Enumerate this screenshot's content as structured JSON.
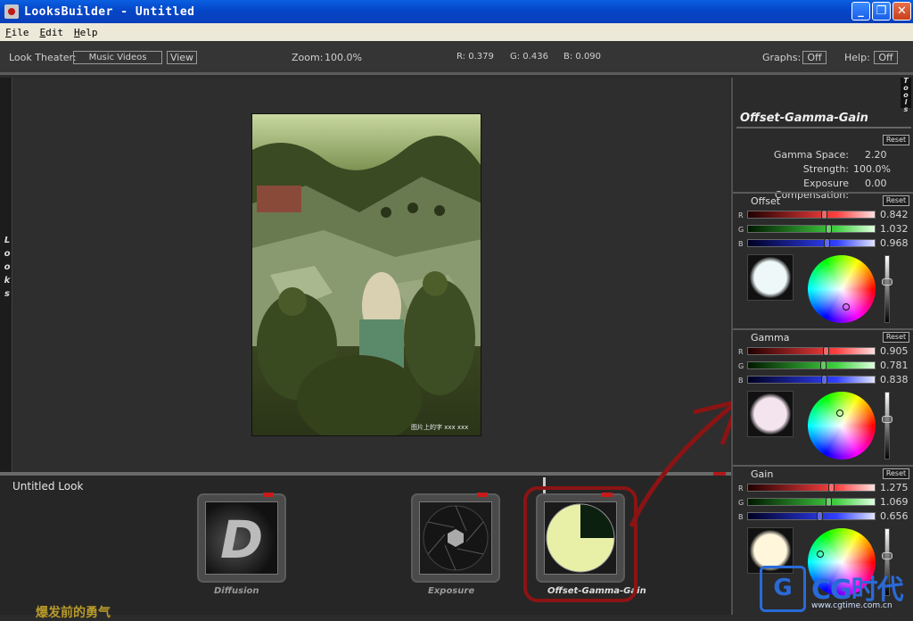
{
  "window": {
    "title": "LooksBuilder - Untitled"
  },
  "menu": {
    "items": [
      "File",
      "Edit",
      "Help"
    ]
  },
  "toolbar": {
    "look_theater_label": "Look Theater:",
    "look_theater_value": "Music Videos",
    "view_button": "View",
    "zoom_label": "Zoom:",
    "zoom_value": "100.0%",
    "r_readout": "R: 0.379",
    "g_readout": "G: 0.436",
    "b_readout": "B: 0.090",
    "graphs_label": "Graphs:",
    "graphs_value": "Off",
    "help_label": "Help:",
    "help_value": "Off"
  },
  "left_strip": {
    "label": "Looks"
  },
  "image": {
    "caption": "图片上的字 xxx xxx"
  },
  "look_panel": {
    "title": "Untitled Look",
    "tools": [
      {
        "label": "Diffusion",
        "glyph": "D"
      },
      {
        "label": "Exposure"
      },
      {
        "label": "Offset-Gamma-Gain"
      }
    ],
    "bottom_text": "爆发前的勇气"
  },
  "right_panel": {
    "tab_label": "Tools",
    "title": "Offset-Gamma-Gain",
    "reset_label": "Reset",
    "params": {
      "gamma_space_label": "Gamma Space:",
      "gamma_space_value": "2.20",
      "strength_label": "Strength:",
      "strength_value": "100.0%",
      "exposure_label": "Exposure Compensation:",
      "exposure_value": "0.00"
    },
    "sections": [
      {
        "name": "Offset",
        "channels": [
          {
            "ch": "R",
            "value": "0.842",
            "fraction": 0.6
          },
          {
            "ch": "G",
            "value": "1.032",
            "fraction": 0.63
          },
          {
            "ch": "B",
            "value": "0.968",
            "fraction": 0.62
          }
        ],
        "swatch_color": "#eef8f8",
        "wheel_dot": [
          0.57,
          0.76
        ],
        "level": 0.38
      },
      {
        "name": "Gamma",
        "channels": [
          {
            "ch": "R",
            "value": "0.905",
            "fraction": 0.61
          },
          {
            "ch": "G",
            "value": "0.781",
            "fraction": 0.59
          },
          {
            "ch": "B",
            "value": "0.838",
            "fraction": 0.6
          }
        ],
        "swatch_color": "#f4e4ee",
        "wheel_dot": [
          0.48,
          0.32
        ],
        "level": 0.4
      },
      {
        "name": "Gain",
        "channels": [
          {
            "ch": "R",
            "value": "1.275",
            "fraction": 0.65
          },
          {
            "ch": "G",
            "value": "1.069",
            "fraction": 0.63
          },
          {
            "ch": "B",
            "value": "0.656",
            "fraction": 0.56
          }
        ],
        "swatch_color": "#fff6dc",
        "wheel_dot": [
          0.18,
          0.38
        ],
        "level": 0.4
      }
    ]
  },
  "watermark": {
    "brand": "CG时代",
    "url": "www.cgtime.com.cn"
  }
}
